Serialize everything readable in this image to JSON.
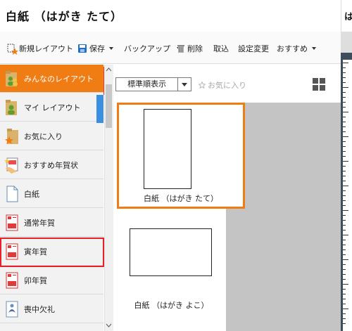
{
  "title": "白紙 （はがき たて）",
  "right_title": "は",
  "toolbar": {
    "new_layout": "新規レイアウト",
    "save": "保存",
    "backup": "バックアップ",
    "delete": "削除",
    "import": "取込",
    "settings": "設定変更",
    "recommend": "おすすめ"
  },
  "sidebar": {
    "items": [
      {
        "label": "みんなのレイアウト",
        "icon": "people-folder-icon"
      },
      {
        "label": "マイ レイアウト",
        "icon": "person-folder-icon"
      },
      {
        "label": "お気に入り",
        "icon": "star-folder-icon"
      },
      {
        "label": "おすすめ年賀状",
        "icon": "recommend-card-icon"
      },
      {
        "label": "白紙",
        "icon": "blank-page-icon"
      },
      {
        "label": "通常年賀",
        "icon": "postcard-icon"
      },
      {
        "label": "寅年賀",
        "icon": "postcard-icon"
      },
      {
        "label": "卯年賀",
        "icon": "postcard-icon"
      },
      {
        "label": "喪中欠礼",
        "icon": "mourning-card-icon"
      }
    ]
  },
  "sort": {
    "label": "標準順表示"
  },
  "favorites_filter": "お気に入り",
  "cards": [
    {
      "label": "白紙 （はがき たて）"
    },
    {
      "label": "白紙 （はがき よこ）"
    }
  ],
  "colors": {
    "accent": "#f07c14",
    "selection": "#e8202a",
    "blue": "#3b8fe0"
  }
}
